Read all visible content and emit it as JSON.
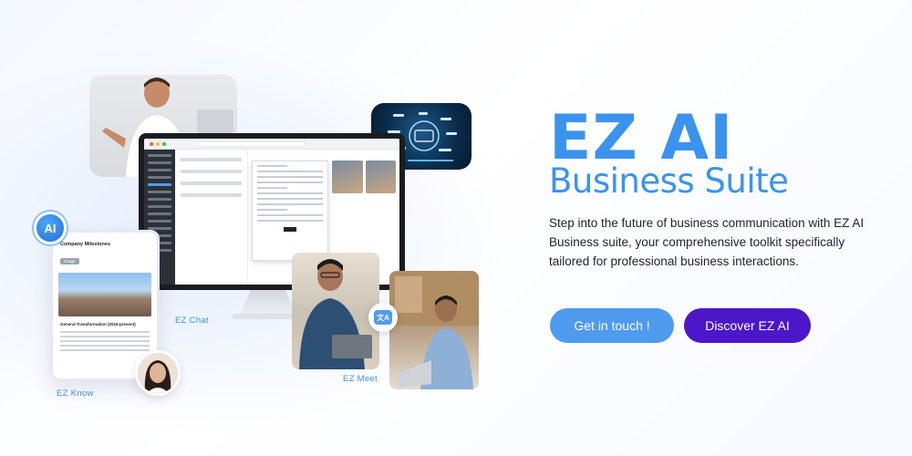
{
  "hero": {
    "title": "EZ AI",
    "subtitle": "Business Suite",
    "description": "Step into the future of business communication with EZ AI Business suite, your comprehensive toolkit specifically tailored for professional business interactions."
  },
  "buttons": {
    "get_in_touch": "Get in touch !",
    "discover": "Discover EZ AI"
  },
  "collage": {
    "ai_badge": "AI",
    "phone_title": "Company Milestones",
    "phone_tag": "Image",
    "phone_subheading": "General Transformation (2016-present)",
    "translate_glyph": "文A",
    "captions": {
      "chat": "EZ Chat",
      "meet": "EZ Meet",
      "know": "EZ Know"
    }
  },
  "colors": {
    "accent": "#3a93ee",
    "button_primary": "#4f9bf0",
    "button_secondary": "#4c16c9"
  },
  "icons": [
    "ai-badge-icon",
    "translate-icon"
  ]
}
